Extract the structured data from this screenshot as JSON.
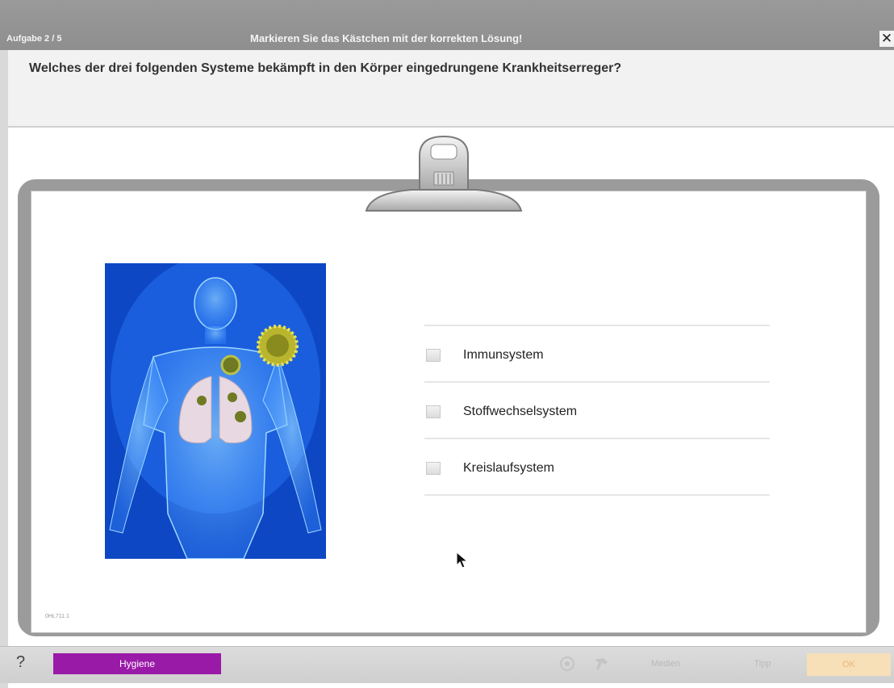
{
  "titlebar": {
    "task_counter": "Aufgabe 2 / 5",
    "instruction": "Markieren Sie das Kästchen mit der korrekten Lösung!",
    "close_label": "✕"
  },
  "question": "Welches der drei folgenden Systeme bekämpft in den Körper eingedrungene Krankheitserreger?",
  "answers": [
    {
      "label": "Immunsystem",
      "checked": false
    },
    {
      "label": "Stoffwechselsystem",
      "checked": false
    },
    {
      "label": "Kreislaufsystem",
      "checked": false
    }
  ],
  "image_code": "0HL711.1",
  "bottombar": {
    "help_label": "?",
    "topic": "Hygiene",
    "back_label": "Medien",
    "tip_label": "Tipp",
    "ok_label": "OK"
  },
  "colors": {
    "titlebar": "#949494",
    "topic": "#9a1aa8",
    "ok_button": "#f7dfb8",
    "photo_blue": "#0f4cc8"
  }
}
